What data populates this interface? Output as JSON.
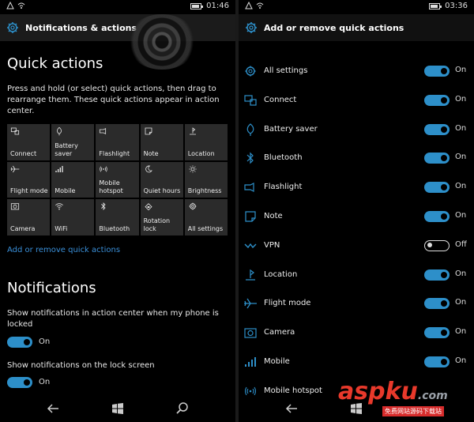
{
  "left": {
    "status": {
      "time": "01:46"
    },
    "header": {
      "title": "Notifications & actions"
    },
    "quick_actions": {
      "heading": "Quick actions",
      "description": "Press and hold (or select) quick actions, then drag to rearrange them. These quick actions appear in action center.",
      "tiles": [
        {
          "label": "Connect",
          "icon": "connect-icon"
        },
        {
          "label": "Battery saver",
          "icon": "battery-saver-icon"
        },
        {
          "label": "Flashlight",
          "icon": "flashlight-icon"
        },
        {
          "label": "Note",
          "icon": "note-icon"
        },
        {
          "label": "Location",
          "icon": "location-icon"
        },
        {
          "label": "Flight mode",
          "icon": "airplane-icon"
        },
        {
          "label": "Mobile",
          "icon": "signal-icon"
        },
        {
          "label": "Mobile hotspot",
          "icon": "hotspot-icon"
        },
        {
          "label": "Quiet hours",
          "icon": "moon-icon"
        },
        {
          "label": "Brightness",
          "icon": "brightness-icon"
        },
        {
          "label": "Camera",
          "icon": "camera-icon"
        },
        {
          "label": "WiFi",
          "icon": "wifi-icon"
        },
        {
          "label": "Bluetooth",
          "icon": "bluetooth-icon"
        },
        {
          "label": "Rotation lock",
          "icon": "rotation-lock-icon"
        },
        {
          "label": "All settings",
          "icon": "gear-icon"
        }
      ],
      "link": "Add or remove quick actions"
    },
    "notifications": {
      "heading": "Notifications",
      "setting1": {
        "label": "Show notifications in action center when my phone is locked",
        "state": "On"
      },
      "setting2": {
        "label": "Show notifications on the lock screen",
        "state": "On"
      }
    }
  },
  "right": {
    "status": {
      "time": "03:36"
    },
    "header": {
      "title": "Add or remove quick actions"
    },
    "items": [
      {
        "label": "All settings",
        "state": "On",
        "icon": "gear-icon"
      },
      {
        "label": "Connect",
        "state": "On",
        "icon": "connect-icon"
      },
      {
        "label": "Battery saver",
        "state": "On",
        "icon": "battery-saver-icon"
      },
      {
        "label": "Bluetooth",
        "state": "On",
        "icon": "bluetooth-icon"
      },
      {
        "label": "Flashlight",
        "state": "On",
        "icon": "flashlight-icon"
      },
      {
        "label": "Note",
        "state": "On",
        "icon": "note-icon"
      },
      {
        "label": "VPN",
        "state": "Off",
        "icon": "vpn-icon"
      },
      {
        "label": "Location",
        "state": "On",
        "icon": "location-icon"
      },
      {
        "label": "Flight mode",
        "state": "On",
        "icon": "airplane-icon"
      },
      {
        "label": "Camera",
        "state": "On",
        "icon": "camera-icon"
      },
      {
        "label": "Mobile",
        "state": "On",
        "icon": "signal-icon"
      },
      {
        "label": "Mobile hotspot",
        "state": "",
        "icon": "hotspot-icon"
      }
    ]
  },
  "watermark": {
    "brand": "aspku",
    "domain": ".com",
    "tagline": "免费网站源码下载站"
  },
  "colors": {
    "accent": "#2d8fc9",
    "link": "#3a8fd8",
    "tile": "#2b2b2b",
    "background": "#000000"
  }
}
